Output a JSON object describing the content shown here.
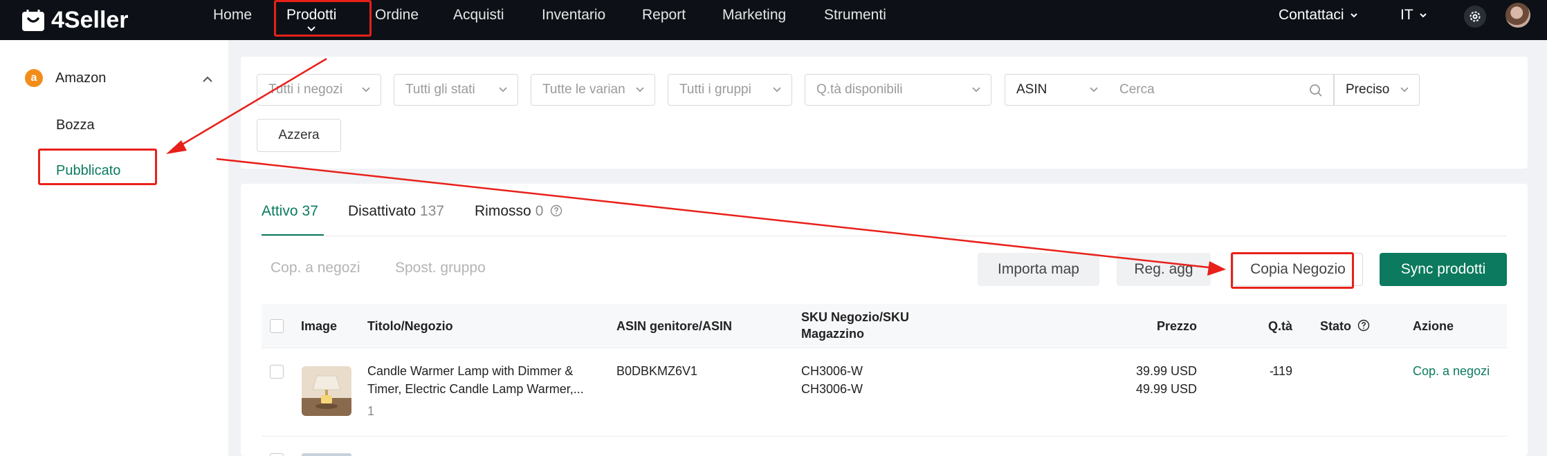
{
  "brand": {
    "name": "4Seller"
  },
  "nav": {
    "items": [
      {
        "label": "Home"
      },
      {
        "label": "Prodotti"
      },
      {
        "label": "Ordine"
      },
      {
        "label": "Acquisti"
      },
      {
        "label": "Inventario"
      },
      {
        "label": "Report"
      },
      {
        "label": "Marketing"
      },
      {
        "label": "Strumenti"
      }
    ],
    "contact_label": "Contattaci",
    "language_label": "IT"
  },
  "sidebar": {
    "platform": "Amazon",
    "platform_icon_letter": "a",
    "items": [
      {
        "label": "Bozza"
      },
      {
        "label": "Pubblicato"
      }
    ]
  },
  "filters": {
    "stores": "Tutti i negozi",
    "statuses": "Tutti gli stati",
    "variants": "Tutte le varian",
    "groups": "Tutti i gruppi",
    "quantity": "Q.tà disponibili",
    "search_field": "ASIN",
    "search_placeholder": "Cerca",
    "match_mode": "Preciso",
    "reset_label": "Azzera"
  },
  "tabs": [
    {
      "label": "Attivo",
      "count": "37"
    },
    {
      "label": "Disattivato",
      "count": "137"
    },
    {
      "label": "Rimosso",
      "count": "0"
    }
  ],
  "toolbar": {
    "copy_to_stores": "Cop. a negozi",
    "move_group": "Spost. gruppo",
    "import_map": "Importa map",
    "update_log": "Reg. agg",
    "copy_store": "Copia Negozio",
    "sync_products": "Sync prodotti"
  },
  "table": {
    "columns": {
      "image": "Image",
      "title": "Titolo/Negozio",
      "asin": "ASIN genitore/ASIN",
      "sku_line1": "SKU Negozio/SKU",
      "sku_line2": "Magazzino",
      "price": "Prezzo",
      "qty": "Q.tà",
      "status": "Stato",
      "action": "Azione"
    },
    "rows": [
      {
        "title_line1": "Candle Warmer Lamp with Dimmer &",
        "title_line2": "Timer, Electric Candle Lamp Warmer,...",
        "store": "1",
        "asin": "B0DBKMZ6V1",
        "sku_store": "CH3006-W",
        "sku_warehouse": "CH3006-W",
        "price_1": "39.99 USD",
        "price_2": "49.99 USD",
        "qty": "119",
        "status": "-",
        "action": "Cop. a negozi"
      }
    ]
  },
  "colors": {
    "accent": "#0b7a5e",
    "topbar": "#0d1117",
    "annotation": "#e8201a"
  }
}
